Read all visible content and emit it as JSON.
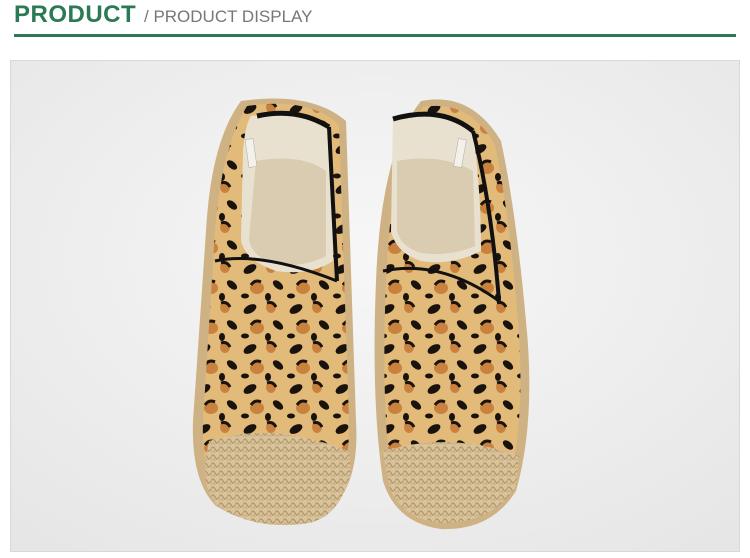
{
  "header": {
    "title": "PRODUCT",
    "subtitle": "/ PRODUCT DISPLAY",
    "accent_color": "#2b7a55"
  },
  "product_image": {
    "name": "leopard-print-espadrille-pair"
  }
}
